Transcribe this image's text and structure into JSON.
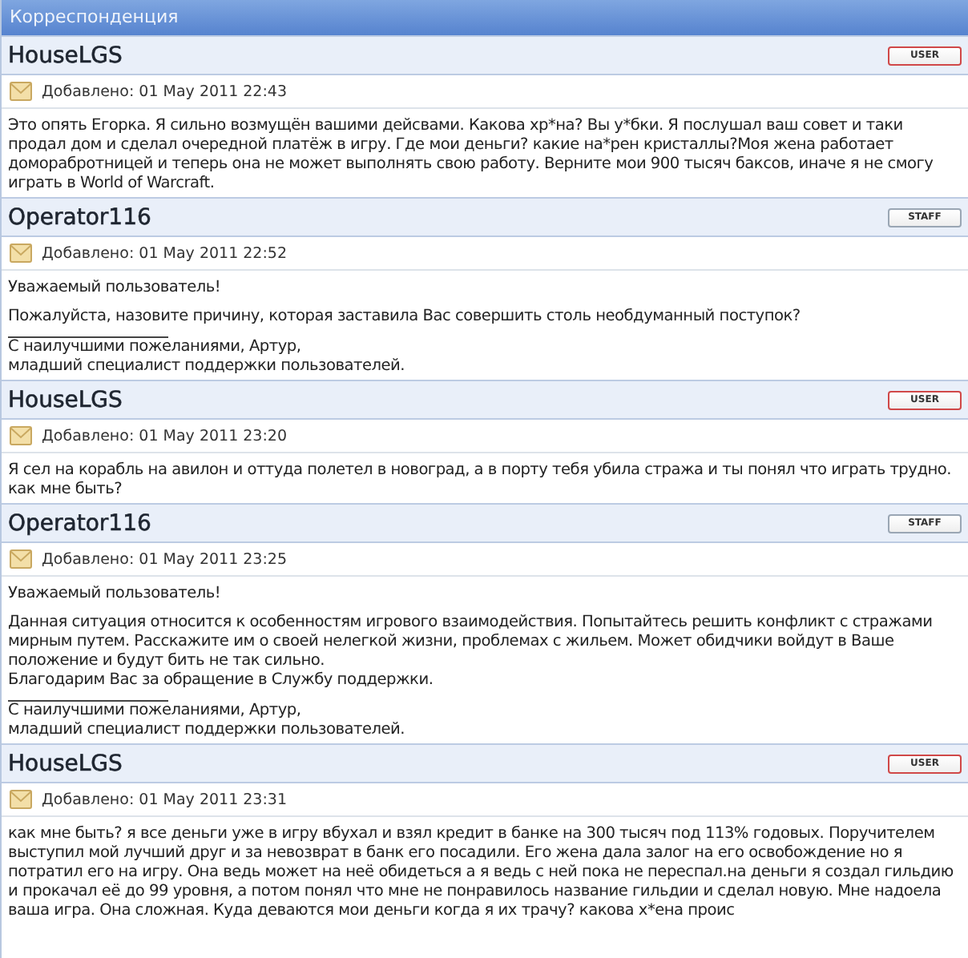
{
  "panel": {
    "title": "Корреспонденция"
  },
  "posts": [
    {
      "author": "HouseLGS",
      "role": {
        "kind": "user",
        "label": "USER"
      },
      "date": "Добавлено: 01 May 2011 22:43",
      "body": [
        {
          "kind": "paragraph",
          "text": "Это опять Егорка. Я сильно возмущён вашими дейсвами. Какова хр*на? Вы у*бки. Я послушал ваш совет и таки продал дом и сделал очередной платёж в игру. Где мои деньги? какие на*рен кристаллы?Моя жена работает доморабротницей и теперь она не может выполнять свою работу. Верните мои 900 тысяч баксов, иначе я не смогу играть в World of Warcraft."
        }
      ]
    },
    {
      "author": "Operator116",
      "role": {
        "kind": "staff",
        "label": "STAFF"
      },
      "date": "Добавлено: 01 May 2011 22:52",
      "body": [
        {
          "kind": "paragraph",
          "text": "Уважаемый пользователь!"
        },
        {
          "kind": "paragraph",
          "text": "Пожалуйста, назовите причину, которая заставила Вас совершить столь необдуманный поступок?"
        },
        {
          "kind": "signature",
          "text": "С наилучшими пожеланиями, Артур,"
        },
        {
          "kind": "line",
          "text": "младший специалист поддержки пользователей."
        }
      ]
    },
    {
      "author": "HouseLGS",
      "role": {
        "kind": "user",
        "label": "USER"
      },
      "date": "Добавлено: 01 May 2011 23:20",
      "body": [
        {
          "kind": "paragraph",
          "text": "Я сел на корабль на авилон и оттуда полетел в новоград, а в порту тебя убила стража и ты понял что играть трудно. как мне быть?"
        }
      ]
    },
    {
      "author": "Operator116",
      "role": {
        "kind": "staff",
        "label": "STAFF"
      },
      "date": "Добавлено: 01 May 2011 23:25",
      "body": [
        {
          "kind": "paragraph",
          "text": "Уважаемый пользователь!"
        },
        {
          "kind": "paragraph",
          "text": "Данная ситуация относится к особенностям игрового взаимодействия. Попытайтесь решить конфликт с стражами мирным путем. Расскажите им о своей нелегкой жизни, проблемах с жильем. Может обидчики войдут в Ваше положение и будут бить не так сильно."
        },
        {
          "kind": "line",
          "text": "Благодарим Вас за обращение в Службу поддержки."
        },
        {
          "kind": "signature",
          "text": "С наилучшими пожеланиями, Артур,"
        },
        {
          "kind": "line",
          "text": "младший специалист поддержки пользователей."
        }
      ]
    },
    {
      "author": "HouseLGS",
      "role": {
        "kind": "user",
        "label": "USER"
      },
      "date": "Добавлено: 01 May 2011 23:31",
      "body": [
        {
          "kind": "paragraph",
          "text": "как мне быть? я все деньги уже в игру вбухал и взял кредит в банке на 300 тысяч под 113% годовых. Поручителем выступил мой лучший друг и за невозврат в банк его посадили. Его жена дала залог на его освобождение но я потратил его на игру. Она ведь может на неё обидеться а я ведь с ней пока не переспал.на деньги я создал гильдию и прокачал её до 99 уровня, а потом понял что мне не понравилось название гильдии и сделал новую. Мне надоела ваша игра. Она сложная. Куда деваются мои деньги когда я их трачу? какова х*ена проис"
        }
      ]
    }
  ]
}
